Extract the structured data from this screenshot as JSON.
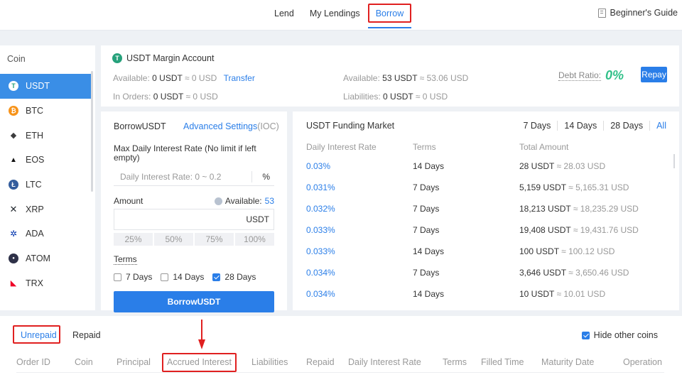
{
  "nav": {
    "tabs": [
      {
        "label": "Lend"
      },
      {
        "label": "My Lendings"
      },
      {
        "label": "Borrow"
      }
    ],
    "guide": "Beginner's Guide"
  },
  "coins": {
    "header": "Coin",
    "items": [
      {
        "name": "USDT",
        "color": "#ffffff",
        "glyph": "T"
      },
      {
        "name": "BTC",
        "color": "#f7931a",
        "glyph": "₿"
      },
      {
        "name": "ETH",
        "color": "#3c3c3d",
        "glyph": "◆"
      },
      {
        "name": "EOS",
        "color": "#111111",
        "glyph": "▲"
      },
      {
        "name": "LTC",
        "color": "#345d9d",
        "glyph": "Ł"
      },
      {
        "name": "XRP",
        "color": "#23292f",
        "glyph": "✕"
      },
      {
        "name": "ADA",
        "color": "#0033ad",
        "glyph": "✲"
      },
      {
        "name": "ATOM",
        "color": "#2e3148",
        "glyph": "●"
      },
      {
        "name": "TRX",
        "color": "#ef0027",
        "glyph": "◣"
      }
    ]
  },
  "account": {
    "title": "USDT Margin Account",
    "available_label": "Available:",
    "available_value": "0 USDT",
    "available_approx": "≈ 0 USD",
    "transfer": "Transfer",
    "in_orders_label": "In Orders:",
    "in_orders_value": "0 USDT",
    "in_orders_approx": "≈ 0 USD",
    "available2_label": "Available:",
    "available2_value": "53 USDT",
    "available2_approx": "≈ 53.06 USD",
    "liabilities_label": "Liabilities:",
    "liabilities_value": "0 USDT",
    "liabilities_approx": "≈ 0 USD",
    "debt_ratio_label": "Debt Ratio:",
    "debt_ratio_value": "0%",
    "repay": "Repay"
  },
  "borrow": {
    "title": "BorrowUSDT",
    "advanced": "Advanced Settings",
    "ioc": "(IOC)",
    "max_rate_label": "Max Daily Interest Rate (No limit if left empty)",
    "rate_placeholder": "Daily Interest Rate: 0 ~ 0.2",
    "rate_unit": "%",
    "amount_label": "Amount",
    "available_label": "Available:",
    "available_value": "53",
    "amount_unit": "USDT",
    "percents": [
      "25%",
      "50%",
      "75%",
      "100%"
    ],
    "terms_label": "Terms",
    "terms": [
      {
        "label": "7 Days",
        "checked": false
      },
      {
        "label": "14 Days",
        "checked": false
      },
      {
        "label": "28 Days",
        "checked": true
      }
    ],
    "button": "BorrowUSDT"
  },
  "market": {
    "title": "USDT Funding Market",
    "filters": [
      "7 Days",
      "14 Days",
      "28 Days",
      "All"
    ],
    "columns": [
      "Daily Interest Rate",
      "Terms",
      "Total Amount"
    ],
    "rows": [
      {
        "rate": "0.03%",
        "term": "14 Days",
        "amount": "28 USDT",
        "approx": "≈ 28.03 USD"
      },
      {
        "rate": "0.031%",
        "term": "7 Days",
        "amount": "5,159 USDT",
        "approx": "≈ 5,165.31 USD"
      },
      {
        "rate": "0.032%",
        "term": "7 Days",
        "amount": "18,213 USDT",
        "approx": "≈ 18,235.29 USD"
      },
      {
        "rate": "0.033%",
        "term": "7 Days",
        "amount": "19,408 USDT",
        "approx": "≈ 19,431.76 USD"
      },
      {
        "rate": "0.033%",
        "term": "14 Days",
        "amount": "100 USDT",
        "approx": "≈ 100.12 USD"
      },
      {
        "rate": "0.034%",
        "term": "7 Days",
        "amount": "3,646 USDT",
        "approx": "≈ 3,650.46 USD"
      },
      {
        "rate": "0.034%",
        "term": "14 Days",
        "amount": "10 USDT",
        "approx": "≈ 10.01 USD"
      }
    ]
  },
  "orders": {
    "tabs": [
      "Unrepaid",
      "Repaid"
    ],
    "hide_other": "Hide other coins",
    "columns": [
      "Order ID",
      "Coin",
      "Principal",
      "Accrued Interest",
      "Liabilities",
      "Repaid",
      "Daily Interest Rate",
      "Terms",
      "Filled Time",
      "Maturity Date",
      "Operation"
    ]
  },
  "colors": {
    "accent": "#2a7ee8",
    "highlight": "#e02020",
    "positive": "#33c18a"
  }
}
